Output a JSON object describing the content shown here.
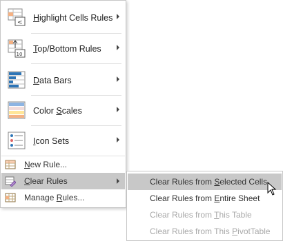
{
  "menu": {
    "items": [
      {
        "label_pre": "",
        "mnemonic": "H",
        "label_post": "ighlight Cells Rules",
        "icon": "highlight-cells-rules-icon"
      },
      {
        "label_pre": "",
        "mnemonic": "T",
        "label_post": "op/Bottom Rules",
        "icon": "top-bottom-rules-icon",
        "icon_text": "10"
      },
      {
        "label_pre": "",
        "mnemonic": "D",
        "label_post": "ata Bars",
        "icon": "data-bars-icon"
      },
      {
        "label_pre": "Color ",
        "mnemonic": "S",
        "label_post": "cales",
        "icon": "color-scales-icon"
      },
      {
        "label_pre": "",
        "mnemonic": "I",
        "label_post": "con Sets",
        "icon": "icon-sets-icon"
      }
    ],
    "small_items": [
      {
        "label_pre": "",
        "mnemonic": "N",
        "label_post": "ew Rule...",
        "icon": "new-rule-icon"
      },
      {
        "label_pre": "",
        "mnemonic": "C",
        "label_post": "lear Rules",
        "icon": "clear-rules-icon"
      },
      {
        "label_pre": "Manage ",
        "mnemonic": "R",
        "label_post": "ules...",
        "icon": "manage-rules-icon"
      }
    ]
  },
  "submenu": {
    "items": [
      {
        "label_pre": "Clear Rules from ",
        "mnemonic": "S",
        "label_post": "elected Cells",
        "state": "highlighted"
      },
      {
        "label_pre": "Clear Rules from ",
        "mnemonic": "E",
        "label_post": "ntire Sheet",
        "state": "enabled"
      },
      {
        "label_pre": "Clear Rules from ",
        "mnemonic": "T",
        "label_post": "his Table",
        "state": "disabled"
      },
      {
        "label_pre": "Clear Rules from This ",
        "mnemonic": "P",
        "label_post": "ivotTable",
        "state": "disabled"
      }
    ]
  },
  "colors": {
    "highlight": "#c8c8c8",
    "disabled_text": "#a8a8a8",
    "icon_blue": "#2e75b6",
    "icon_orange": "#f4b183",
    "icon_red": "#e06666"
  }
}
